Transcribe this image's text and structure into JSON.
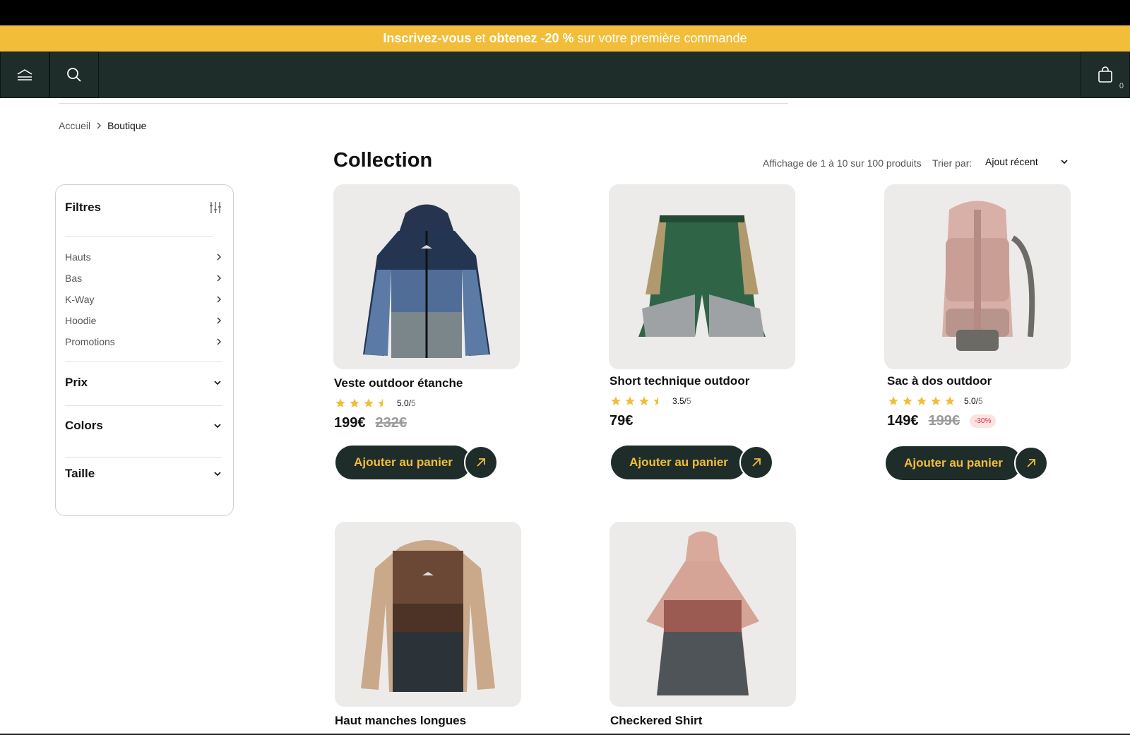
{
  "promo": {
    "part1": "Inscrivez-vous",
    "part2": "et",
    "part3": "obtenez -20 %",
    "part4": "sur votre première commande"
  },
  "nav": {
    "cart_count": "0"
  },
  "breadcrumb": {
    "home": "Accueil",
    "current": "Boutique"
  },
  "filters": {
    "title": "Filtres",
    "categories": [
      "Hauts",
      "Bas",
      "K-Way",
      "Hoodie",
      "Promotions"
    ],
    "price_label": "Prix",
    "colors_label": "Colors",
    "size_label": "Taille"
  },
  "listing": {
    "heading": "Collection",
    "results_info": "Affichage de 1 à 10 sur 100 produits",
    "sort_label": "Trier par:",
    "sort_value": "Ajout récent"
  },
  "products": [
    {
      "name": "Veste outdoor étanche",
      "rating": 3.5,
      "score": "5.0/",
      "score_den": "5",
      "price": "199€",
      "old_price": "232€",
      "badge": "",
      "cta": "Ajouter au panier"
    },
    {
      "name": "Short technique outdoor",
      "rating": 3.5,
      "score": "3.5/",
      "score_den": "5",
      "price": "79€",
      "old_price": "",
      "badge": "",
      "cta": "Ajouter au panier"
    },
    {
      "name": "Sac à dos outdoor",
      "rating": 5,
      "score": "5.0/",
      "score_den": "5",
      "price": "149€",
      "old_price": "199€",
      "badge": "-30%",
      "cta": "Ajouter au panier"
    },
    {
      "name": "Haut manches longues"
    },
    {
      "name": "Checkered Shirt"
    }
  ],
  "colors": {
    "accent": "#f2bd39",
    "dark": "#1f2d2a",
    "card_bg": "#ecebe9",
    "star": "#f2bd39"
  }
}
